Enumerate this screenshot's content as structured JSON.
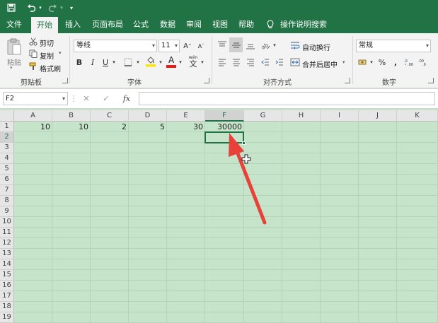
{
  "quick_access": {
    "save_icon": "save-icon",
    "undo_icon": "undo-icon",
    "redo_icon": "redo-icon",
    "customize_icon": "customize-qat-icon"
  },
  "menu_tabs": [
    "文件",
    "开始",
    "插入",
    "页面布局",
    "公式",
    "数据",
    "审阅",
    "视图",
    "帮助"
  ],
  "active_tab": "开始",
  "tell_me": "操作说明搜索",
  "clipboard": {
    "paste": "粘贴",
    "cut": "剪切",
    "copy": "复制",
    "format_painter": "格式刷",
    "group": "剪贴板"
  },
  "font": {
    "name": "等线",
    "size": "11",
    "bold": "B",
    "italic": "I",
    "underline": "U",
    "font_color_letter": "A",
    "grow": "A",
    "shrink": "A",
    "wen": "wén",
    "wen_char": "文",
    "group": "字体"
  },
  "alignment": {
    "wrap_text": "自动换行",
    "merge_center": "合并后居中",
    "group": "对齐方式"
  },
  "number": {
    "format": "常规",
    "percent": "%",
    "comma": ",",
    "group": "数字"
  },
  "formula_bar": {
    "name_box": "F2",
    "cancel": "✕",
    "enter": "✓",
    "fx": "fx",
    "value": ""
  },
  "sheet": {
    "columns": [
      "A",
      "B",
      "C",
      "D",
      "E",
      "F",
      "G",
      "H",
      "I",
      "J",
      "K"
    ],
    "rows": [
      "1",
      "2",
      "3",
      "4",
      "5",
      "6",
      "7",
      "8",
      "9",
      "10",
      "11",
      "12",
      "13",
      "14",
      "15",
      "16",
      "17",
      "18",
      "19"
    ],
    "row1_values": [
      "10",
      "10",
      "2",
      "5",
      "30",
      "30000"
    ],
    "selected_column": "F",
    "selected_row": "2",
    "active_cell": "F2"
  },
  "colors": {
    "excel_green": "#217346",
    "sheet_background": "#c6e4c9",
    "arrow": "#e8413a",
    "font_color_bar": "#e0201a",
    "fill_color_bar": "#ffe600"
  }
}
